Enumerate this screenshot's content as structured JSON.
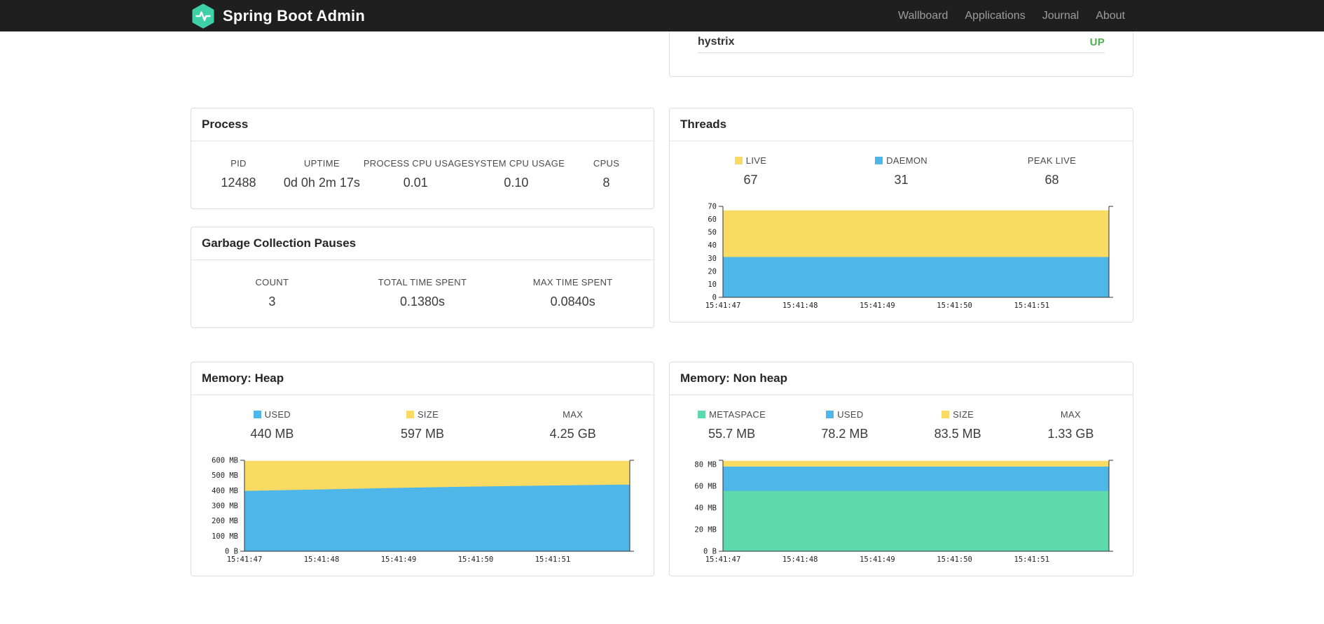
{
  "navbar": {
    "brand": "Spring Boot Admin",
    "links": [
      {
        "label": "Wallboard"
      },
      {
        "label": "Applications"
      },
      {
        "label": "Journal"
      },
      {
        "label": "About"
      }
    ]
  },
  "colors": {
    "navbar_bg": "#1F1F1F",
    "brand_teal": "#3ED0A6",
    "status_up": "#4CAF50",
    "chart_blue": "#4FB6EA",
    "chart_yellow": "#F9DB64",
    "chart_green": "#5DD9AE"
  },
  "service_panel": {
    "name": "hystrix",
    "status": "UP"
  },
  "panels": {
    "process": {
      "title": "Process",
      "metrics": [
        {
          "label": "PID",
          "value": "12488"
        },
        {
          "label": "UPTIME",
          "value": "0d 0h 2m 17s"
        },
        {
          "label": "PROCESS CPU USAGE",
          "value": "0.01"
        },
        {
          "label": "SYSTEM CPU USAGE",
          "value": "0.10"
        },
        {
          "label": "CPUS",
          "value": "8"
        }
      ]
    },
    "gc": {
      "title": "Garbage Collection Pauses",
      "metrics": [
        {
          "label": "COUNT",
          "value": "3"
        },
        {
          "label": "TOTAL TIME SPENT",
          "value": "0.1380s"
        },
        {
          "label": "MAX TIME SPENT",
          "value": "0.0840s"
        }
      ]
    },
    "threads": {
      "title": "Threads",
      "legend": [
        {
          "label": "LIVE",
          "value": "67",
          "color": "#F9DB64"
        },
        {
          "label": "DAEMON",
          "value": "31",
          "color": "#4FB6EA"
        },
        {
          "label": "PEAK LIVE",
          "value": "68"
        }
      ]
    },
    "heap": {
      "title": "Memory: Heap",
      "legend": [
        {
          "label": "USED",
          "value": "440 MB",
          "color": "#4FB6EA"
        },
        {
          "label": "SIZE",
          "value": "597 MB",
          "color": "#F9DB64"
        },
        {
          "label": "MAX",
          "value": "4.25 GB"
        }
      ]
    },
    "nonheap": {
      "title": "Memory: Non heap",
      "legend": [
        {
          "label": "METASPACE",
          "value": "55.7 MB",
          "color": "#5DD9AE"
        },
        {
          "label": "USED",
          "value": "78.2 MB",
          "color": "#4FB6EA"
        },
        {
          "label": "SIZE",
          "value": "83.5 MB",
          "color": "#F9DB64"
        },
        {
          "label": "MAX",
          "value": "1.33 GB"
        }
      ]
    }
  },
  "chart_data": [
    {
      "type": "area",
      "title": "Threads",
      "x_labels": [
        "15:41:47",
        "15:41:48",
        "15:41:49",
        "15:41:50",
        "15:41:51"
      ],
      "ylim": [
        0,
        70
      ],
      "yticks": [
        {
          "v": 0,
          "label": "0"
        },
        {
          "v": 10,
          "label": "10"
        },
        {
          "v": 20,
          "label": "20"
        },
        {
          "v": 30,
          "label": "30"
        },
        {
          "v": 40,
          "label": "40"
        },
        {
          "v": 50,
          "label": "50"
        },
        {
          "v": 60,
          "label": "60"
        },
        {
          "v": 70,
          "label": "70"
        }
      ],
      "series": [
        {
          "name": "LIVE",
          "color": "#F9DB64",
          "values": [
            67,
            67,
            67,
            67,
            67,
            67
          ]
        },
        {
          "name": "DAEMON",
          "color": "#4FB6EA",
          "values": [
            31,
            31,
            31,
            31,
            31,
            31
          ]
        }
      ]
    },
    {
      "type": "area",
      "title": "Memory: Heap",
      "x_labels": [
        "15:41:47",
        "15:41:48",
        "15:41:49",
        "15:41:50",
        "15:41:51"
      ],
      "ylim": [
        0,
        600
      ],
      "yticks": [
        {
          "v": 0,
          "label": "0 B"
        },
        {
          "v": 100,
          "label": "100 MB"
        },
        {
          "v": 200,
          "label": "200 MB"
        },
        {
          "v": 300,
          "label": "300 MB"
        },
        {
          "v": 400,
          "label": "400 MB"
        },
        {
          "v": 500,
          "label": "500 MB"
        },
        {
          "v": 600,
          "label": "600 MB"
        }
      ],
      "series": [
        {
          "name": "SIZE",
          "color": "#F9DB64",
          "values": [
            597,
            597,
            597,
            597,
            597,
            597
          ]
        },
        {
          "name": "USED",
          "color": "#4FB6EA",
          "values": [
            398,
            408,
            418,
            427,
            434,
            440
          ]
        }
      ]
    },
    {
      "type": "area",
      "title": "Memory: Non heap",
      "x_labels": [
        "15:41:47",
        "15:41:48",
        "15:41:49",
        "15:41:50",
        "15:41:51"
      ],
      "ylim": [
        0,
        84
      ],
      "yticks": [
        {
          "v": 0,
          "label": "0 B"
        },
        {
          "v": 20,
          "label": "20 MB"
        },
        {
          "v": 40,
          "label": "40 MB"
        },
        {
          "v": 60,
          "label": "60 MB"
        },
        {
          "v": 80,
          "label": "80 MB"
        }
      ],
      "series": [
        {
          "name": "SIZE",
          "color": "#F9DB64",
          "values": [
            83.5,
            83.5,
            83.5,
            83.5,
            83.5,
            83.5
          ]
        },
        {
          "name": "USED",
          "color": "#4FB6EA",
          "values": [
            78.2,
            78.2,
            78.2,
            78.2,
            78.2,
            78.2
          ]
        },
        {
          "name": "METASPACE",
          "color": "#5DD9AE",
          "values": [
            55.7,
            55.7,
            55.7,
            55.7,
            55.7,
            55.7
          ]
        }
      ]
    }
  ]
}
